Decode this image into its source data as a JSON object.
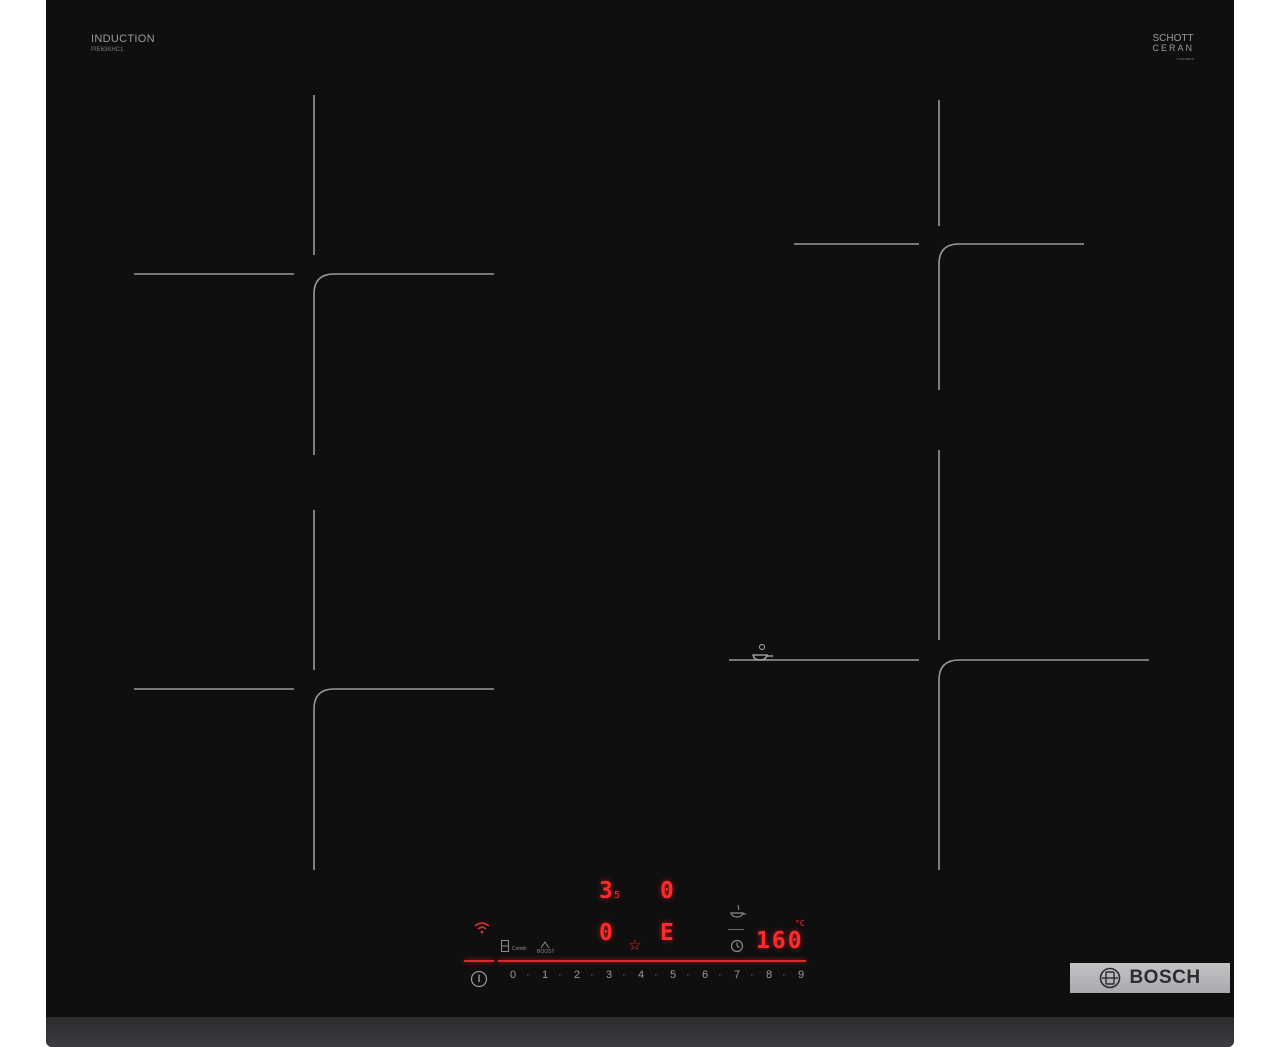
{
  "branding": {
    "induction_label": "INDUCTION",
    "model_code": "PIE63KHC1",
    "glass_brand_line1": "SCHOTT",
    "glass_brand_line2": "CERAN",
    "glass_note": "innovated",
    "maker": "BOSCH"
  },
  "control_panel": {
    "power_levels": [
      "0",
      "1",
      "2",
      "3",
      "4",
      "5",
      "6",
      "7",
      "8",
      "9"
    ],
    "display_power_a": "3",
    "display_power_a_sub": "5",
    "display_power_b": "0",
    "display_power_c": "0",
    "display_power_d": "E",
    "display_temp": "160",
    "temp_unit": "°C",
    "combi_label": "Combi",
    "boost_label": "BOOST"
  },
  "colors": {
    "glass": "#0f0f10",
    "display_red": "#ff2a2a",
    "zone_lines": "#9a9a9a"
  },
  "icons": [
    "wifi-icon",
    "power-icon",
    "favorite-star-icon",
    "timer-icon",
    "frying-sensor-icon",
    "pan-sensor-icon",
    "bosch-logo-icon",
    "combi-zone-icon",
    "boost-icon"
  ]
}
